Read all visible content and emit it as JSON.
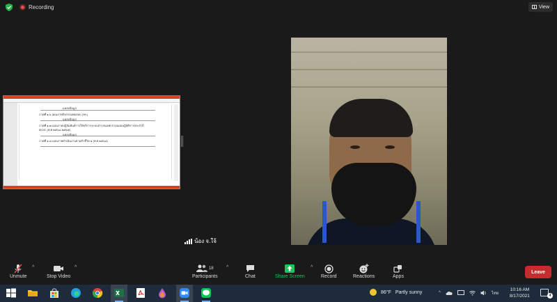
{
  "topbar": {
    "recording_label": "Recording",
    "view_label": "View"
  },
  "participant": {
    "name": "น้อง จ.ใจ้"
  },
  "shared_doc": {
    "lines": [
      "ภาพที่ ๑.๖ แผนภาพกิจกรรมทดสอบ (รพ.)",
      "ภาพที่ ๑.๗ แผนภาพปฏิสัมพันธ์การให้บริการระบบสารสนเทศ ตามแผนปฏิบัติการประจำปี",
      "MOIC (พ.ศ.๒๕๖๔-๒๕๖๕)",
      "ภาพที่ ๑.๘ แผนภาพดำเนินงานตามตัวชี้วัด ๑ (พ.ศ.๒๕๖๔)"
    ],
    "sublabels": [
      "แหล่งข้อมูล",
      "แหล่งข้อมูล",
      "แหล่งข้อมูล"
    ]
  },
  "toolbar": {
    "unmute": "Unmute",
    "stop_video": "Stop Video",
    "participants": "Participants",
    "participants_count": "18",
    "chat": "Chat",
    "share_screen": "Share Screen",
    "record": "Record",
    "reactions": "Reactions",
    "apps": "Apps",
    "leave": "Leave"
  },
  "taskbar": {
    "weather_temp": "86°F",
    "weather_desc": "Partly sunny",
    "language": "ไทย",
    "time": "10:16 AM",
    "date": "8/17/2021",
    "notifications": "4"
  },
  "colors": {
    "share_green": "#22c25a",
    "leave_red": "#c72c2c",
    "taskbar": "#1e2b3b"
  }
}
